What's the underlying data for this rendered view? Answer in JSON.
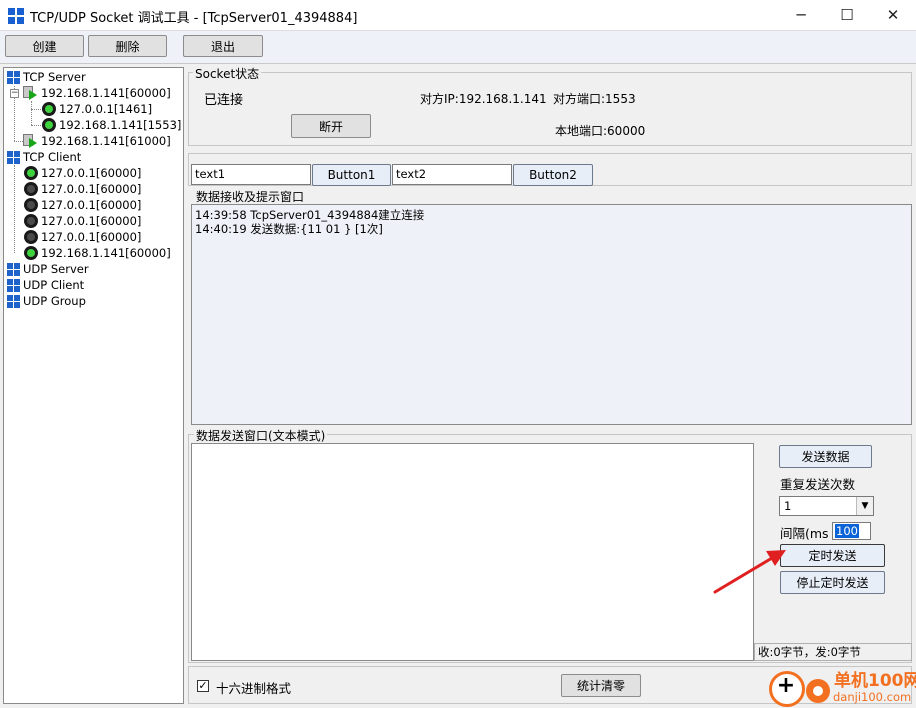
{
  "window": {
    "title": "TCP/UDP Socket 调试工具 - [TcpServer01_4394884]",
    "minimize": "─",
    "maximize": "☐",
    "close": "✕"
  },
  "toolbar": {
    "create_label": "创建",
    "delete_label": "删除",
    "exit_label": "退出"
  },
  "tree": {
    "tcp_server": "TCP Server",
    "server_main": "192.168.1.141[60000]",
    "server_child_1": "127.0.0.1[1461]",
    "server_child_2": "192.168.1.141[1553]",
    "server_second": "192.168.1.141[61000]",
    "tcp_client": "TCP Client",
    "clients": [
      "127.0.0.1[60000]",
      "127.0.0.1[60000]",
      "127.0.0.1[60000]",
      "127.0.0.1[60000]",
      "127.0.0.1[60000]",
      "192.168.1.141[60000]"
    ],
    "udp_server": "UDP Server",
    "udp_client": "UDP Client",
    "udp_group": "UDP Group"
  },
  "socket_status": {
    "group_title": "Socket状态",
    "connection_state": "已连接",
    "peer_ip": "对方IP:192.168.1.141",
    "peer_port": "对方端口:1553",
    "local_port": "本地端口:60000",
    "disconnect_label": "断开"
  },
  "custom_bar": {
    "text1_value": "text1",
    "button1_label": "Button1",
    "text2_value": "text2",
    "button2_label": "Button2"
  },
  "receive": {
    "group_title": "数据接收及提示窗口",
    "lines": [
      "14:39:58 TcpServer01_4394884建立连接",
      "14:40:19 发送数据:{11 01 } [1次]"
    ]
  },
  "send": {
    "group_title": "数据发送窗口(文本模式)",
    "send_label": "发送数据",
    "repeat_label": "重复发送次数",
    "repeat_value": "1",
    "interval_label": "间隔(ms",
    "interval_value": "100",
    "timed_send_label": "定时发送",
    "stop_timed_label": "停止定时发送",
    "stats": "收:0字节，发:0字节"
  },
  "bottom": {
    "hex_checked": "✓",
    "hex_label": "十六进制格式",
    "reset_stats_label": "统计清零"
  },
  "watermark": {
    "name": "单机100网",
    "url": "danji100.com"
  },
  "colors": {
    "annotation_arrow": "#e02020",
    "watermark": "#f37021"
  }
}
